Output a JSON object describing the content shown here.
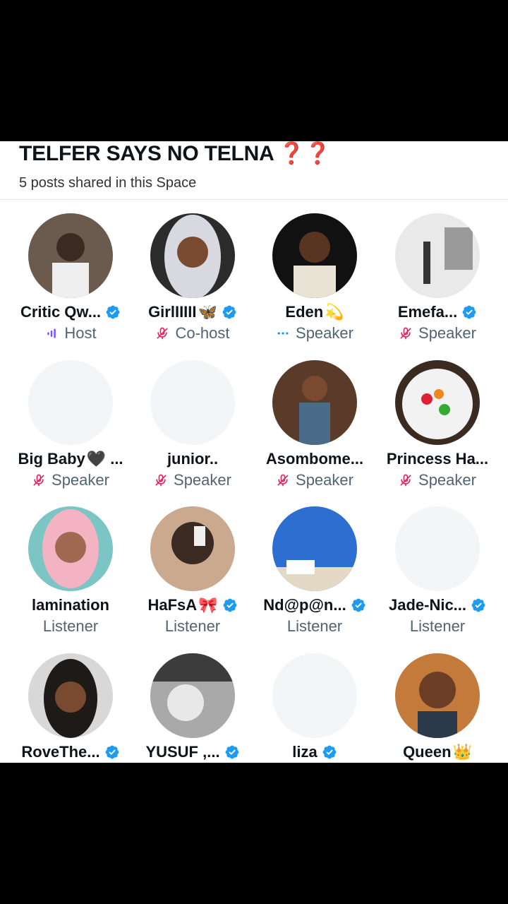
{
  "space": {
    "title": "TELFER SAYS NO TELNA",
    "title_marks": "❓❓",
    "subtitle": "5 posts shared in this Space"
  },
  "colors": {
    "verified": "#1d9bf0",
    "muted": "#e0245e",
    "host": "#7856ff",
    "divider": "#e6e6e6"
  },
  "participants": [
    {
      "name": "Critic Qw...",
      "role": "Host",
      "verified": true,
      "role_icon": "speaking-bars-icon"
    },
    {
      "name": "GirlIIIII",
      "emoji": "🦋",
      "role": "Co-host",
      "verified": true,
      "role_icon": "mic-off-icon"
    },
    {
      "name": "Eden",
      "emoji": "💫",
      "role": "Speaker",
      "verified": false,
      "role_icon": "ellipsis-icon"
    },
    {
      "name": "Emefa...",
      "role": "Speaker",
      "verified": true,
      "role_icon": "mic-off-icon"
    },
    {
      "name": "Big Baby",
      "emoji": "🖤",
      "suffix": "...",
      "role": "Speaker",
      "verified": false,
      "role_icon": "mic-off-icon"
    },
    {
      "name": "junior..",
      "role": "Speaker",
      "verified": false,
      "role_icon": "mic-off-icon"
    },
    {
      "name": "Asombome...",
      "role": "Speaker",
      "verified": false,
      "role_icon": "mic-off-icon"
    },
    {
      "name": "Princess Ha...",
      "role": "Speaker",
      "verified": false,
      "role_icon": "mic-off-icon"
    },
    {
      "name": "lamination",
      "role": "Listener",
      "verified": false
    },
    {
      "name": "HaFsA",
      "emoji": "🎀",
      "role": "Listener",
      "verified": true
    },
    {
      "name": "Nd@p@n...",
      "role": "Listener",
      "verified": true
    },
    {
      "name": "Jade-Nic...",
      "role": "Listener",
      "verified": true
    },
    {
      "name": "RoveThe...",
      "role": "",
      "verified": true
    },
    {
      "name": "YUSUF ,...",
      "role": "",
      "verified": true
    },
    {
      "name": "liza",
      "role": "",
      "verified": true
    },
    {
      "name": "Queen",
      "emoji": "👑",
      "role": "",
      "verified": false
    }
  ]
}
